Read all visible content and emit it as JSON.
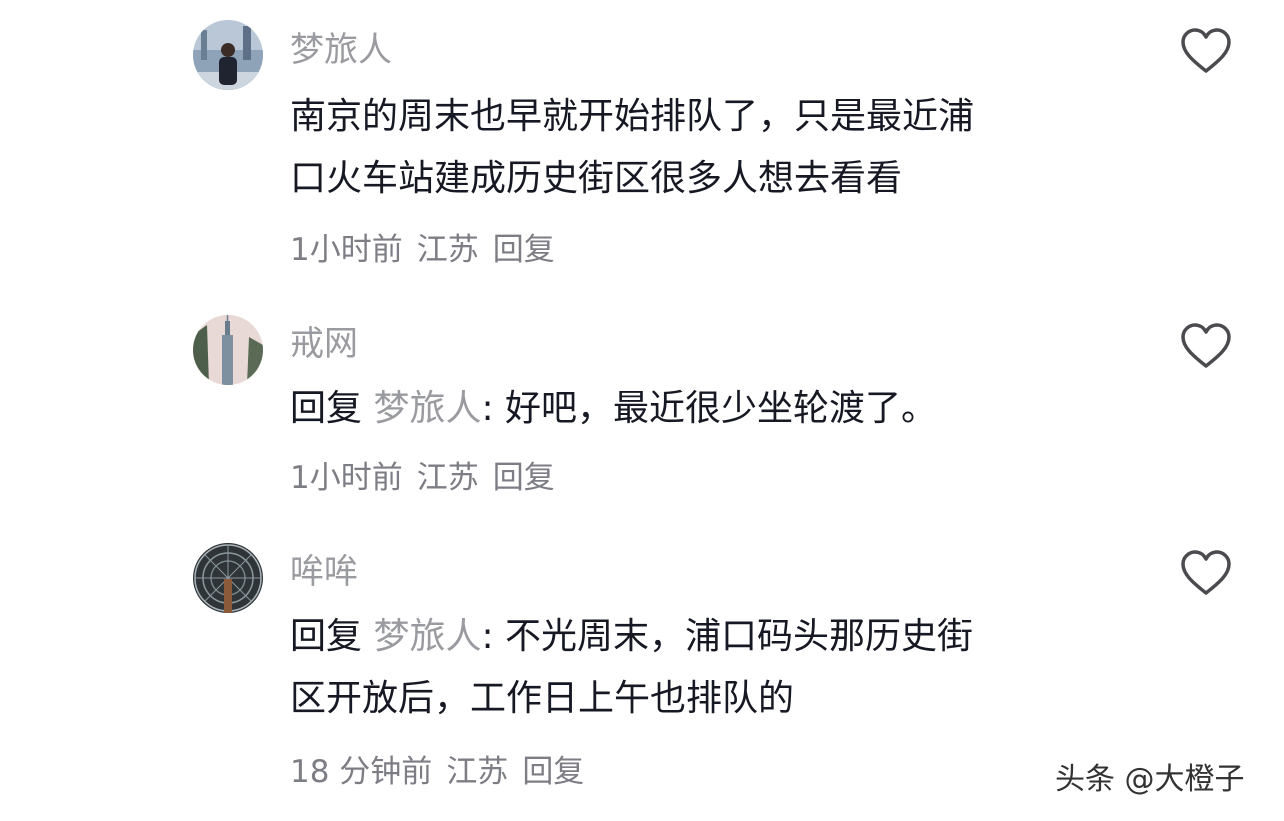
{
  "comments": [
    {
      "username": "梦旅人",
      "body_lines": [
        "南京的周末也早就开始排队了，只是最近浦",
        "口火车站建成历史街区很多人想去看看"
      ],
      "time": "1小时前",
      "location": "江苏",
      "reply_label": "回复",
      "avatar_icon": "person-cityscape-avatar"
    },
    {
      "username": "戒网",
      "reply_prefix": "回复",
      "reply_target": "梦旅人",
      "body_lines": [
        ": 好吧，最近很少坐轮渡了。"
      ],
      "time": "1小时前",
      "location": "江苏",
      "reply_label": "回复",
      "avatar_icon": "tower-avatar"
    },
    {
      "username": "哞哞",
      "reply_prefix": "回复",
      "reply_target": "梦旅人",
      "body_lines": [
        ": 不光周末，浦口码头那历史街",
        "区开放后，工作日上午也排队的"
      ],
      "time": "18 分钟前",
      "location": "江苏",
      "reply_label": "回复",
      "avatar_icon": "dome-avatar"
    }
  ],
  "like_icon": "heart-outline-icon",
  "watermark": "头条 @大橙子"
}
